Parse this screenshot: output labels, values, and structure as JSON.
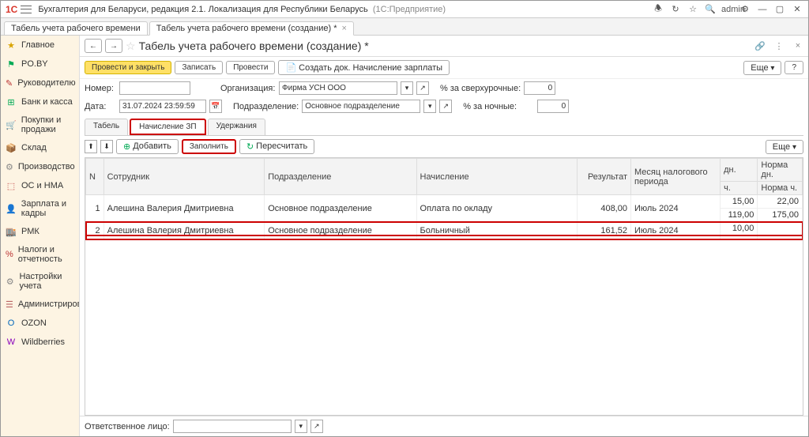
{
  "app": {
    "title": "Бухгалтерия для Беларуси, редакция 2.1. Локализация для Республики Беларусь",
    "platform": "(1С:Предприятие)",
    "user": "admin"
  },
  "main_tabs": [
    {
      "label": "Табель учета рабочего времени"
    },
    {
      "label": "Табель учета рабочего времени (создание) *"
    }
  ],
  "sidebar": {
    "items": [
      {
        "icon": "★",
        "color": "#d9a400",
        "label": "Главное"
      },
      {
        "icon": "⚑",
        "color": "#0a5",
        "label": "PO.BY"
      },
      {
        "icon": "✎",
        "color": "#b33",
        "label": "Руководителю"
      },
      {
        "icon": "⊞",
        "color": "#0a5",
        "label": "Банк и касса"
      },
      {
        "icon": "🛒",
        "color": "#0a5",
        "label": "Покупки и продажи"
      },
      {
        "icon": "📦",
        "color": "#b88",
        "label": "Склад"
      },
      {
        "icon": "⚙",
        "color": "#888",
        "label": "Производство"
      },
      {
        "icon": "⬚",
        "color": "#b33",
        "label": "ОС и НМА"
      },
      {
        "icon": "👤",
        "color": "#4a8",
        "label": "Зарплата и кадры"
      },
      {
        "icon": "🏬",
        "color": "#b33",
        "label": "РМК"
      },
      {
        "icon": "%",
        "color": "#b33",
        "label": "Налоги и отчетность"
      },
      {
        "icon": "⚙",
        "color": "#888",
        "label": "Настройки учета"
      },
      {
        "icon": "☰",
        "color": "#b66",
        "label": "Администрирование"
      },
      {
        "icon": "O",
        "color": "#06b",
        "label": "OZON"
      },
      {
        "icon": "W",
        "color": "#80b",
        "label": "Wildberries"
      }
    ]
  },
  "page": {
    "title": "Табель учета рабочего времени (создание) *",
    "cmds": {
      "post_close": "Провести и закрыть",
      "save": "Записать",
      "post": "Провести",
      "create_payroll": "Создать док. Начисление зарплаты",
      "more": "Еще"
    },
    "fields": {
      "number_label": "Номер:",
      "number": "",
      "org_label": "Организация:",
      "org": "Фирма УСН ООО",
      "date_label": "Дата:",
      "date": "31.07.2024 23:59:59",
      "dept_label": "Подразделение:",
      "dept": "Основное подразделение",
      "overtime_label": "% за сверхурочные:",
      "overtime": "0",
      "night_label": "% за ночные:",
      "night": "0"
    },
    "subtabs": {
      "t1": "Табель",
      "t2": "Начисление ЗП",
      "t3": "Удержания"
    },
    "inner_cmds": {
      "add": "Добавить",
      "fill": "Заполнить",
      "recalc": "Пересчитать",
      "more": "Еще"
    },
    "cols": {
      "n": "N",
      "emp": "Сотрудник",
      "dept": "Подразделение",
      "accrual": "Начисление",
      "result": "Результат",
      "period": "Месяц налогового периода",
      "days": "дн.",
      "hours": "ч.",
      "norm_d": "Норма дн.",
      "norm_h": "Норма ч."
    },
    "rows": [
      {
        "n": "1",
        "emp": "Алешина Валерия Дмитриевна",
        "dept": "Основное подразделение",
        "accrual": "Оплата по окладу",
        "result": "408,00",
        "period": "Июль 2024",
        "days": "15,00",
        "hours": "119,00",
        "norm_d": "22,00",
        "norm_h": "175,00"
      },
      {
        "n": "2",
        "emp": "Алешина Валерия Дмитриевна",
        "dept": "Основное подразделение",
        "accrual": "Больничный",
        "result": "161,52",
        "period": "Июль 2024",
        "days": "10,00",
        "hours": "",
        "norm_d": "",
        "norm_h": ""
      }
    ],
    "footer": {
      "label": "Ответственное лицо:"
    }
  }
}
